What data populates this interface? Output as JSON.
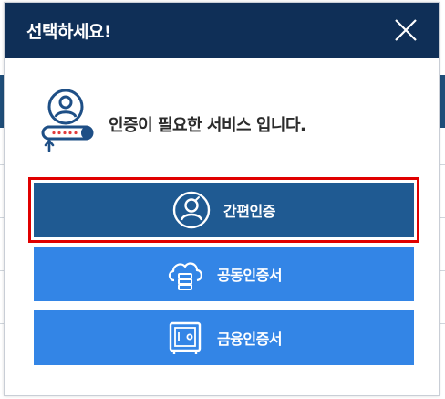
{
  "modal": {
    "title": "선택하세요!",
    "close_icon": "close-x-icon"
  },
  "intro": {
    "icon": "user-key-icon",
    "message": "인증이 필요한 서비스 입니다."
  },
  "options": [
    {
      "label": "간편인증",
      "icon": "user-circle-icon",
      "bg_color": "#1f5a92",
      "highlighted": true,
      "highlight_color": "#e00000"
    },
    {
      "label": "공동인증서",
      "icon": "cloud-server-icon",
      "bg_color": "#3385e6",
      "highlighted": false
    },
    {
      "label": "금융인증서",
      "icon": "safe-icon",
      "bg_color": "#3385e6",
      "highlighted": false
    }
  ],
  "colors": {
    "header_bg": "#0f2f57",
    "accent_navy": "#1f4e79"
  }
}
